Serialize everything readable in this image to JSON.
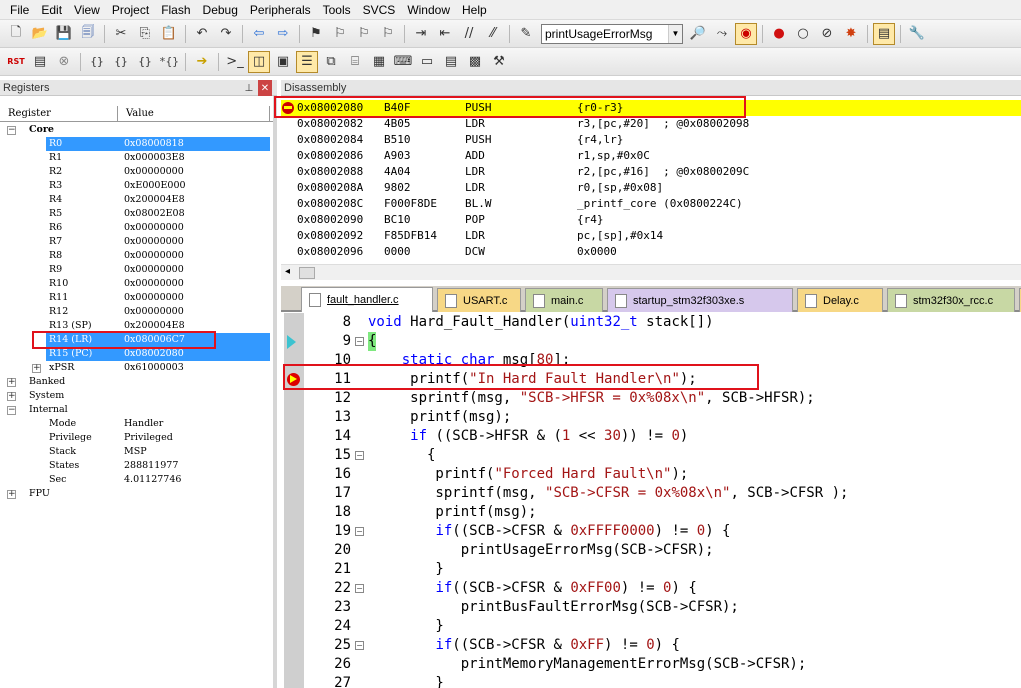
{
  "menu": [
    "File",
    "Edit",
    "View",
    "Project",
    "Flash",
    "Debug",
    "Peripherals",
    "Tools",
    "SVCS",
    "Window",
    "Help"
  ],
  "toolbar": {
    "function_combo": "printUsageErrorMsg",
    "row1_icons": [
      "new-file-icon",
      "open-folder-icon",
      "save-icon",
      "save-all-icon",
      "cut-icon",
      "copy-icon",
      "paste-icon",
      "undo-icon",
      "redo-icon",
      "nav-back-icon",
      "nav-forward-icon",
      "bookmark-icon",
      "bookmark-prev-icon",
      "bookmark-next-icon",
      "bookmark-clear-icon",
      "indent-icon",
      "unindent-icon",
      "comment-icon",
      "uncomment-icon",
      "find-in-files-icon"
    ],
    "row1_right_icons": [
      "find-icon",
      "goto-icon",
      "debug-session-icon",
      "breakpoint-icon",
      "breakpoint-disable-icon",
      "breakpoint-disable-all-icon",
      "breakpoint-kill-icon",
      "view-config-icon",
      "settings-icon"
    ],
    "row2_icons": [
      "reset-icon",
      "run-icon",
      "stop-icon",
      "step-in-icon",
      "step-over-icon",
      "step-out-icon",
      "run-to-cursor-icon",
      "show-next-statement-icon",
      "command-window-icon",
      "disassembly-window-icon",
      "symbols-window-icon",
      "registers-window-icon",
      "call-stack-icon",
      "watch-window-icon",
      "memory-window-icon",
      "serial-window-icon",
      "analysis-window-icon",
      "trace-window-icon",
      "system-viewer-icon",
      "toolbox-icon"
    ]
  },
  "registers": {
    "title": "Registers",
    "columns": [
      "Register",
      "Value"
    ],
    "rows": [
      {
        "name": "Core",
        "value": "",
        "level": 0,
        "toggle": "-",
        "bold": true,
        "selected": false
      },
      {
        "name": "R0",
        "value": "0x08000818",
        "level": 2,
        "toggle": "",
        "selected": true
      },
      {
        "name": "R1",
        "value": "0x000003E8",
        "level": 2,
        "toggle": "",
        "selected": false
      },
      {
        "name": "R2",
        "value": "0x00000000",
        "level": 2,
        "toggle": "",
        "selected": false
      },
      {
        "name": "R3",
        "value": "0xE000E000",
        "level": 2,
        "toggle": "",
        "selected": false
      },
      {
        "name": "R4",
        "value": "0x200004E8",
        "level": 2,
        "toggle": "",
        "selected": false
      },
      {
        "name": "R5",
        "value": "0x08002E08",
        "level": 2,
        "toggle": "",
        "selected": false
      },
      {
        "name": "R6",
        "value": "0x00000000",
        "level": 2,
        "toggle": "",
        "selected": false
      },
      {
        "name": "R7",
        "value": "0x00000000",
        "level": 2,
        "toggle": "",
        "selected": false
      },
      {
        "name": "R8",
        "value": "0x00000000",
        "level": 2,
        "toggle": "",
        "selected": false
      },
      {
        "name": "R9",
        "value": "0x00000000",
        "level": 2,
        "toggle": "",
        "selected": false
      },
      {
        "name": "R10",
        "value": "0x00000000",
        "level": 2,
        "toggle": "",
        "selected": false
      },
      {
        "name": "R11",
        "value": "0x00000000",
        "level": 2,
        "toggle": "",
        "selected": false
      },
      {
        "name": "R12",
        "value": "0x00000000",
        "level": 2,
        "toggle": "",
        "selected": false
      },
      {
        "name": "R13 (SP)",
        "value": "0x200004E8",
        "level": 2,
        "toggle": "",
        "selected": false
      },
      {
        "name": "R14 (LR)",
        "value": "0x080006C7",
        "level": 2,
        "toggle": "",
        "selected": true
      },
      {
        "name": "R15 (PC)",
        "value": "0x08002080",
        "level": 2,
        "toggle": "",
        "selected": true
      },
      {
        "name": "xPSR",
        "value": "0x61000003",
        "level": 1,
        "toggle": "+",
        "selected": false
      },
      {
        "name": "Banked",
        "value": "",
        "level": 0,
        "toggle": "+",
        "selected": false
      },
      {
        "name": "System",
        "value": "",
        "level": 0,
        "toggle": "+",
        "selected": false
      },
      {
        "name": "Internal",
        "value": "",
        "level": 0,
        "toggle": "-",
        "selected": false
      },
      {
        "name": "Mode",
        "value": "Handler",
        "level": 2,
        "toggle": "",
        "selected": false
      },
      {
        "name": "Privilege",
        "value": "Privileged",
        "level": 2,
        "toggle": "",
        "selected": false
      },
      {
        "name": "Stack",
        "value": "MSP",
        "level": 2,
        "toggle": "",
        "selected": false
      },
      {
        "name": "States",
        "value": "288811977",
        "level": 2,
        "toggle": "",
        "selected": false
      },
      {
        "name": "Sec",
        "value": "4.01127746",
        "level": 2,
        "toggle": "",
        "selected": false
      },
      {
        "name": "FPU",
        "value": "",
        "level": 0,
        "toggle": "+",
        "selected": false
      }
    ]
  },
  "disassembly": {
    "title": "Disassembly",
    "rows": [
      {
        "addr": "0x08002080",
        "op": "B40F",
        "mn": "PUSH",
        "args": "{r0-r3}",
        "current": true
      },
      {
        "addr": "0x08002082",
        "op": "4B05",
        "mn": "LDR",
        "args": "r3,[pc,#20]  ; @0x08002098",
        "current": false
      },
      {
        "addr": "0x08002084",
        "op": "B510",
        "mn": "PUSH",
        "args": "{r4,lr}",
        "current": false
      },
      {
        "addr": "0x08002086",
        "op": "A903",
        "mn": "ADD",
        "args": "r1,sp,#0x0C",
        "current": false
      },
      {
        "addr": "0x08002088",
        "op": "4A04",
        "mn": "LDR",
        "args": "r2,[pc,#16]  ; @0x0800209C",
        "current": false
      },
      {
        "addr": "0x0800208A",
        "op": "9802",
        "mn": "LDR",
        "args": "r0,[sp,#0x08]",
        "current": false
      },
      {
        "addr": "0x0800208C",
        "op": "F000F8DE",
        "mn": "BL.W",
        "args": "_printf_core (0x0800224C)",
        "current": false
      },
      {
        "addr": "0x08002090",
        "op": "BC10",
        "mn": "POP",
        "args": "{r4}",
        "current": false
      },
      {
        "addr": "0x08002092",
        "op": "F85DFB14",
        "mn": "LDR",
        "args": "pc,[sp],#0x14",
        "current": false
      },
      {
        "addr": "0x08002096",
        "op": "0000",
        "mn": "DCW",
        "args": "0x0000",
        "current": false
      }
    ]
  },
  "editor": {
    "tabs": [
      {
        "label": "fault_handler.c",
        "color": "#f7d886",
        "active": true
      },
      {
        "label": "USART.c",
        "color": "#f7d886",
        "active": false
      },
      {
        "label": "main.c",
        "color": "#c8d8a4",
        "active": false
      },
      {
        "label": "startup_stm32f303xe.s",
        "color": "#d6c8ec",
        "active": false
      },
      {
        "label": "Delay.c",
        "color": "#f7d886",
        "active": false
      },
      {
        "label": "stm32f30x_rcc.c",
        "color": "#c8d8a4",
        "active": false
      },
      {
        "label": "system_stm32f30x.c",
        "color": "#f7d886",
        "active": false
      }
    ],
    "lines": [
      {
        "n": "8",
        "code": "void Hard_Fault_Handler(uint32_t stack[])",
        "marker": "",
        "fold": ""
      },
      {
        "n": "9",
        "code": "{",
        "marker": "arrow",
        "fold": "-"
      },
      {
        "n": "10",
        "code": "    static char msg[80];",
        "marker": "",
        "fold": ""
      },
      {
        "n": "11",
        "code": "     printf(\"In Hard Fault Handler\\n\");",
        "marker": "bp",
        "fold": ""
      },
      {
        "n": "12",
        "code": "     sprintf(msg, \"SCB->HFSR = 0x%08x\\n\", SCB->HFSR);",
        "marker": "",
        "fold": ""
      },
      {
        "n": "13",
        "code": "     printf(msg);",
        "marker": "",
        "fold": ""
      },
      {
        "n": "14",
        "code": "     if ((SCB->HFSR & (1 << 30)) != 0)",
        "marker": "",
        "fold": ""
      },
      {
        "n": "15",
        "code": "       {",
        "marker": "",
        "fold": "-"
      },
      {
        "n": "16",
        "code": "        printf(\"Forced Hard Fault\\n\");",
        "marker": "",
        "fold": ""
      },
      {
        "n": "17",
        "code": "        sprintf(msg, \"SCB->CFSR = 0x%08x\\n\", SCB->CFSR );",
        "marker": "",
        "fold": ""
      },
      {
        "n": "18",
        "code": "        printf(msg);",
        "marker": "",
        "fold": ""
      },
      {
        "n": "19",
        "code": "        if((SCB->CFSR & 0xFFFF0000) != 0) {",
        "marker": "",
        "fold": "-"
      },
      {
        "n": "20",
        "code": "           printUsageErrorMsg(SCB->CFSR);",
        "marker": "",
        "fold": ""
      },
      {
        "n": "21",
        "code": "        }",
        "marker": "",
        "fold": ""
      },
      {
        "n": "22",
        "code": "        if((SCB->CFSR & 0xFF00) != 0) {",
        "marker": "",
        "fold": "-"
      },
      {
        "n": "23",
        "code": "           printBusFaultErrorMsg(SCB->CFSR);",
        "marker": "",
        "fold": ""
      },
      {
        "n": "24",
        "code": "        }",
        "marker": "",
        "fold": ""
      },
      {
        "n": "25",
        "code": "        if((SCB->CFSR & 0xFF) != 0) {",
        "marker": "",
        "fold": "-"
      },
      {
        "n": "26",
        "code": "           printMemoryManagementErrorMsg(SCB->CFSR);",
        "marker": "",
        "fold": ""
      },
      {
        "n": "27",
        "code": "        }",
        "marker": "",
        "fold": ""
      }
    ]
  },
  "colors": {
    "selection": "#3399ff",
    "current_line": "#ffff00",
    "annotation": "#e0121b",
    "keyword": "#0000ff",
    "string": "#a31515"
  }
}
